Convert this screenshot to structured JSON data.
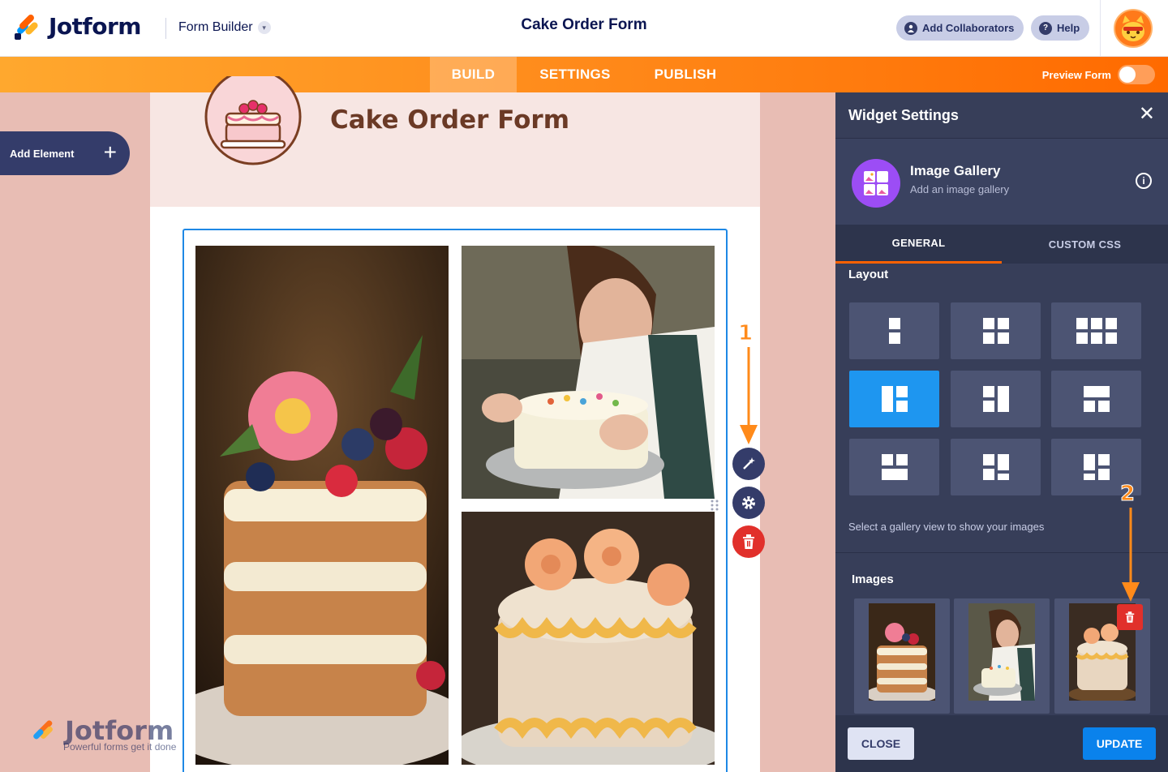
{
  "header": {
    "brand": "Jotform",
    "builder_menu": "Form Builder",
    "form_title": "Cake Order Form",
    "add_collaborators": "Add Collaborators",
    "help": "Help"
  },
  "nav": {
    "tabs": [
      "BUILD",
      "SETTINGS",
      "PUBLISH"
    ],
    "active_tab": "BUILD",
    "preview_label": "Preview Form",
    "preview_on": false
  },
  "builder": {
    "add_element": "Add Element",
    "form_heading": "Cake Order Form"
  },
  "annotations": {
    "first": "1",
    "second": "2"
  },
  "panel": {
    "title": "Widget Settings",
    "widget_name": "Image Gallery",
    "widget_desc": "Add an image gallery",
    "tabs": [
      "GENERAL",
      "CUSTOM CSS"
    ],
    "active_tab": "GENERAL",
    "layout_label": "Layout",
    "layout_selected_index": 3,
    "layout_hint": "Select a gallery view to show your images",
    "images_label": "Images",
    "close_label": "CLOSE",
    "update_label": "UPDATE"
  },
  "watermark": {
    "brand": "Jotform",
    "tagline": "Powerful forms get it done"
  },
  "colors": {
    "brand_orange": "#ff6100",
    "panel_bg": "#373e59",
    "accent_blue": "#1e96f0",
    "delete_red": "#e1302b"
  }
}
